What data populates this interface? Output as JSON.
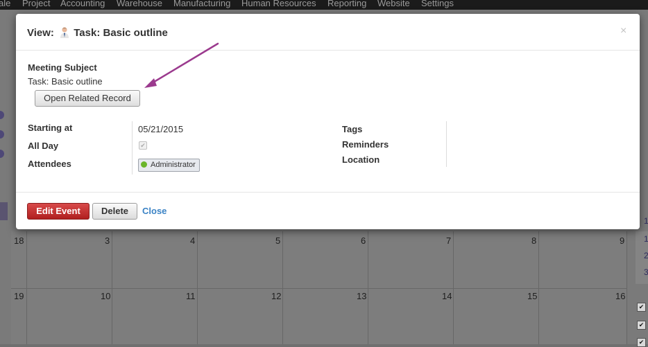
{
  "nav": {
    "items": [
      "ale",
      "Project",
      "Accounting",
      "Warehouse",
      "Manufacturing",
      "Human Resources",
      "Reporting",
      "Website",
      "Settings"
    ]
  },
  "background": {
    "week1_days": [
      "18",
      "3",
      "4",
      "5",
      "6",
      "7",
      "8",
      "9"
    ],
    "week2_days": [
      "19",
      "10",
      "11",
      "12",
      "13",
      "14",
      "15",
      "16"
    ],
    "side_numbers": [
      "1",
      "1",
      "2",
      "3"
    ]
  },
  "modal": {
    "title_prefix": "View:",
    "title_text": "Task: Basic outline",
    "close_glyph": "×",
    "meeting_subject_label": "Meeting Subject",
    "meeting_subject_value": "Task: Basic outline",
    "open_related_label": "Open Related Record",
    "fields": {
      "starting_at_label": "Starting at",
      "starting_at_value": "05/21/2015",
      "all_day_label": "All Day",
      "all_day_checked": true,
      "attendees_label": "Attendees",
      "attendee_name": "Administrator",
      "tags_label": "Tags",
      "reminders_label": "Reminders",
      "location_label": "Location"
    },
    "footer": {
      "edit_label": "Edit Event",
      "delete_label": "Delete",
      "close_label": "Close"
    }
  },
  "colors": {
    "edit_button": "#c62828",
    "link": "#3b83c5",
    "arrow": "#9b3a8e",
    "status_online": "#6ab52a"
  },
  "icons": {
    "avatar": "user-avatar-icon",
    "checkbox": "check-icon",
    "close": "close-icon"
  }
}
